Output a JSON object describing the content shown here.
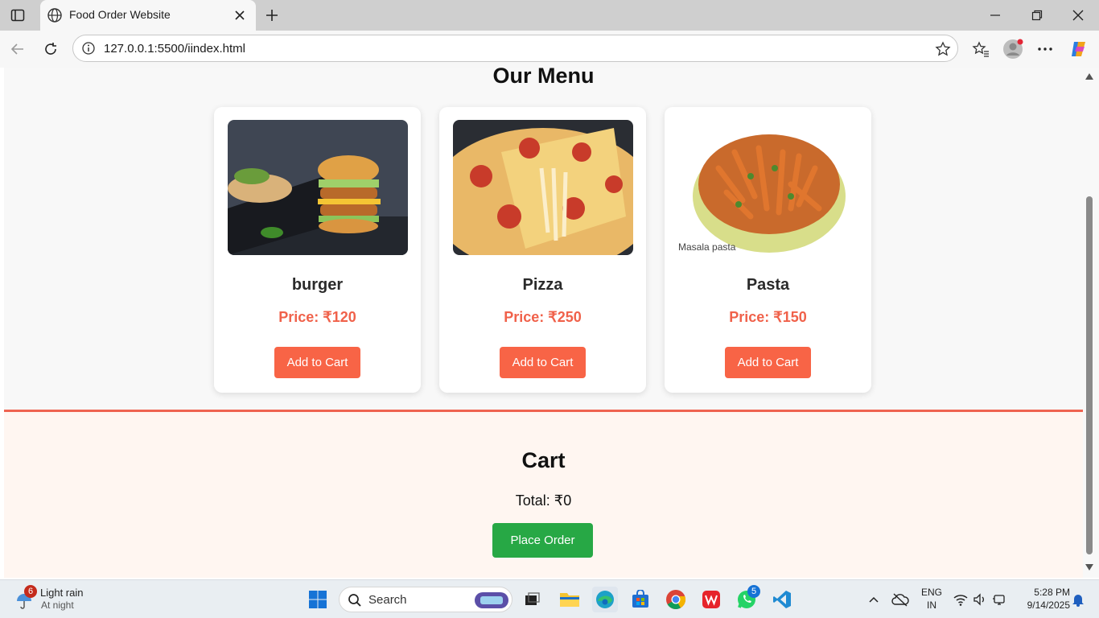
{
  "browser": {
    "tab_title": "Food Order Website",
    "url": "127.0.0.1:5500/iindex.html"
  },
  "page": {
    "heading": "Our Menu",
    "items": [
      {
        "name": "burger",
        "price": "Price: ₹120",
        "button": "Add to Cart",
        "image_icon": "burger-image"
      },
      {
        "name": "Pizza",
        "price": "Price: ₹250",
        "button": "Add to Cart",
        "image_icon": "pizza-image"
      },
      {
        "name": "Pasta",
        "price": "Price: ₹150",
        "button": "Add to Cart",
        "image_icon": "pasta-image",
        "image_caption": "Masala pasta"
      }
    ],
    "cart": {
      "title": "Cart",
      "total": "Total: ₹0",
      "place_order": "Place Order"
    }
  },
  "taskbar": {
    "weather": {
      "badge": "6",
      "condition": "Light rain",
      "sub": "At night"
    },
    "search_label": "Search",
    "whatsapp_badge": "5",
    "lang_1": "ENG",
    "lang_2": "IN",
    "time": "5:28 PM",
    "date": "9/14/2025"
  },
  "colors": {
    "accent": "#f86446",
    "price": "#f0614a",
    "order": "#27a845",
    "cart_bg": "#fff6f1"
  }
}
